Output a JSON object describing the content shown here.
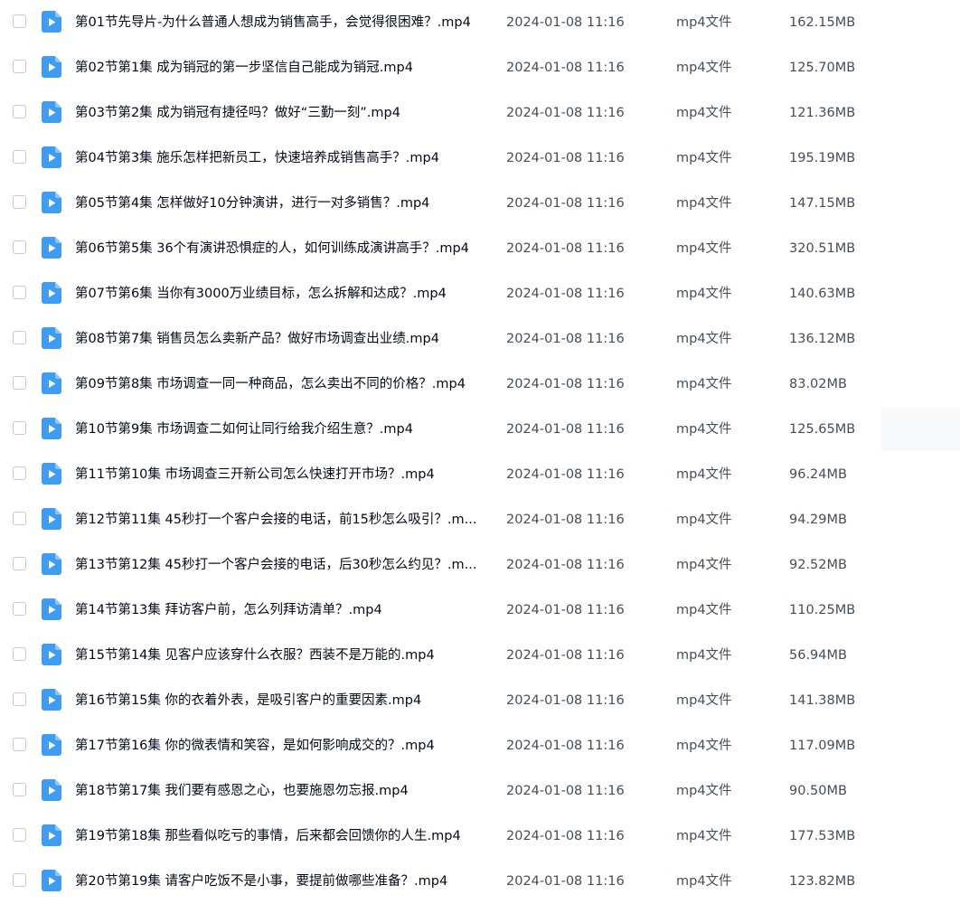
{
  "file_list": {
    "rows": [
      {
        "name": "第01节先导片-为什么普通人想成为销售高手，会觉得很困难？.mp4",
        "date": "2024-01-08 11:16",
        "type": "mp4文件",
        "size": "162.15MB",
        "icon": "video-file-icon"
      },
      {
        "name": "第02节第1集 成为销冠的第一步坚信自己能成为销冠.mp4",
        "date": "2024-01-08 11:16",
        "type": "mp4文件",
        "size": "125.70MB",
        "icon": "video-file-icon"
      },
      {
        "name": "第03节第2集 成为销冠有捷径吗？做好“三勤一刻”.mp4",
        "date": "2024-01-08 11:16",
        "type": "mp4文件",
        "size": "121.36MB",
        "icon": "video-file-icon"
      },
      {
        "name": "第04节第3集 施乐怎样把新员工，快速培养成销售高手？.mp4",
        "date": "2024-01-08 11:16",
        "type": "mp4文件",
        "size": "195.19MB",
        "icon": "video-file-icon"
      },
      {
        "name": "第05节第4集 怎样做好10分钟演讲，进行一对多销售？.mp4",
        "date": "2024-01-08 11:16",
        "type": "mp4文件",
        "size": "147.15MB",
        "icon": "video-file-icon"
      },
      {
        "name": "第06节第5集 36个有演讲恐惧症的人，如何训练成演讲高手？.mp4",
        "date": "2024-01-08 11:16",
        "type": "mp4文件",
        "size": "320.51MB",
        "icon": "video-file-icon"
      },
      {
        "name": "第07节第6集 当你有3000万业绩目标，怎么拆解和达成？.mp4",
        "date": "2024-01-08 11:16",
        "type": "mp4文件",
        "size": "140.63MB",
        "icon": "video-file-icon"
      },
      {
        "name": "第08节第7集 销售员怎么卖新产品？做好市场调查出业绩.mp4",
        "date": "2024-01-08 11:16",
        "type": "mp4文件",
        "size": "136.12MB",
        "icon": "video-file-icon"
      },
      {
        "name": "第09节第8集 市场调查一同一种商品，怎么卖出不同的价格？.mp4",
        "date": "2024-01-08 11:16",
        "type": "mp4文件",
        "size": "83.02MB",
        "icon": "video-file-icon"
      },
      {
        "name": "第10节第9集 市场调查二如何让同行给我介绍生意？.mp4",
        "date": "2024-01-08 11:16",
        "type": "mp4文件",
        "size": "125.65MB",
        "icon": "video-file-icon"
      },
      {
        "name": "第11节第10集 市场调查三开新公司怎么快速打开市场？.mp4",
        "date": "2024-01-08 11:16",
        "type": "mp4文件",
        "size": "96.24MB",
        "icon": "video-file-icon"
      },
      {
        "name": "第12节第11集 45秒打一个客户会接的电话，前15秒怎么吸引？.m...",
        "date": "2024-01-08 11:16",
        "type": "mp4文件",
        "size": "94.29MB",
        "icon": "video-file-icon"
      },
      {
        "name": "第13节第12集 45秒打一个客户会接的电话，后30秒怎么约见？.m...",
        "date": "2024-01-08 11:16",
        "type": "mp4文件",
        "size": "92.52MB",
        "icon": "video-file-icon"
      },
      {
        "name": "第14节第13集 拜访客户前，怎么列拜访清单？.mp4",
        "date": "2024-01-08 11:16",
        "type": "mp4文件",
        "size": "110.25MB",
        "icon": "video-file-icon"
      },
      {
        "name": "第15节第14集 见客户应该穿什么衣服？西装不是万能的.mp4",
        "date": "2024-01-08 11:16",
        "type": "mp4文件",
        "size": "56.94MB",
        "icon": "video-file-icon"
      },
      {
        "name": "第16节第15集 你的衣着外表，是吸引客户的重要因素.mp4",
        "date": "2024-01-08 11:16",
        "type": "mp4文件",
        "size": "141.38MB",
        "icon": "video-file-icon"
      },
      {
        "name": "第17节第16集 你的微表情和笑容，是如何影响成交的？.mp4",
        "date": "2024-01-08 11:16",
        "type": "mp4文件",
        "size": "117.09MB",
        "icon": "video-file-icon"
      },
      {
        "name": "第18节第17集 我们要有感恩之心，也要施恩勿忘报.mp4",
        "date": "2024-01-08 11:16",
        "type": "mp4文件",
        "size": "90.50MB",
        "icon": "video-file-icon"
      },
      {
        "name": "第19节第18集 那些看似吃亏的事情，后来都会回馈你的人生.mp4",
        "date": "2024-01-08 11:16",
        "type": "mp4文件",
        "size": "177.53MB",
        "icon": "video-file-icon"
      },
      {
        "name": "第20节第19集 请客户吃饭不是小事，要提前做哪些准备？.mp4",
        "date": "2024-01-08 11:16",
        "type": "mp4文件",
        "size": "123.82MB",
        "icon": "video-file-icon"
      }
    ]
  },
  "colors": {
    "icon_blue": "#3d9cf5",
    "text_primary": "#03081a",
    "text_secondary": "#454d5a",
    "checkbox_border": "#c4c9d2"
  }
}
